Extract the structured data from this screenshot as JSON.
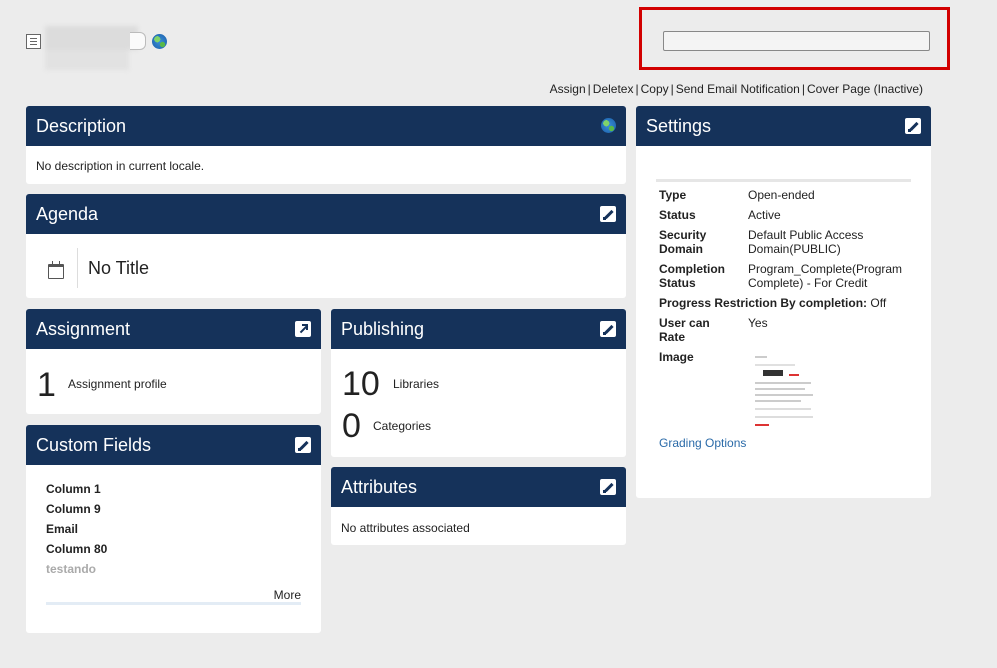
{
  "header": {
    "actions": [
      "Assign",
      "Deletex",
      "Copy",
      "Send Email Notification",
      "Cover Page (Inactive)"
    ]
  },
  "description": {
    "title": "Description",
    "text": "No description in current locale."
  },
  "agenda": {
    "title": "Agenda",
    "item_title": "No Title"
  },
  "assignment": {
    "title": "Assignment",
    "count": "1",
    "label": "Assignment profile"
  },
  "custom_fields": {
    "title": "Custom Fields",
    "items": [
      "Column 1",
      "Column 9",
      "Email",
      "Column 80",
      "testando"
    ],
    "more": "More"
  },
  "publishing": {
    "title": "Publishing",
    "libraries_count": "10",
    "libraries_label": "Libraries",
    "categories_count": "0",
    "categories_label": "Categories"
  },
  "attributes": {
    "title": "Attributes",
    "text": "No attributes associated"
  },
  "settings": {
    "title": "Settings",
    "type_k": "Type",
    "type_v": "Open-ended",
    "status_k": "Status",
    "status_v": "Active",
    "domain_k": "Security Domain",
    "domain_v": "Default Public Access Domain(PUBLIC)",
    "completion_k": "Completion Status",
    "completion_v": "Program_Complete(Program Complete) - For Credit",
    "progress_k": "Progress Restriction By completion:",
    "progress_v": "Off",
    "rate_k": "User can Rate",
    "rate_v": "Yes",
    "image_k": "Image",
    "grading": "Grading Options"
  },
  "colors": {
    "panel_header": "#15325a",
    "highlight": "#d20000",
    "link": "#2a6aa8",
    "background": "#ececec"
  }
}
